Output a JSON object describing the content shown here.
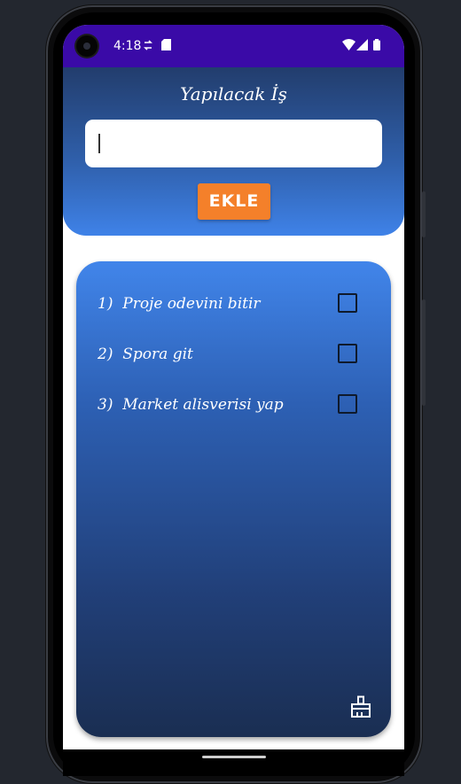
{
  "status_bar": {
    "time": "4:18",
    "left_icons": [
      "sync-icon",
      "sd-card-icon"
    ],
    "right_icons": [
      "wifi-icon",
      "signal-icon",
      "battery-icon"
    ],
    "color": "#3a0aa7"
  },
  "header": {
    "title": "Yapılacak İş",
    "input": {
      "value": "",
      "placeholder": ""
    },
    "add_button_label": "EKLE",
    "add_button_color": "#f4802a"
  },
  "tasks": [
    {
      "number": "1)",
      "text": "Proje odevini bitir",
      "checked": false
    },
    {
      "number": "2)",
      "text": "Spora git",
      "checked": false
    },
    {
      "number": "3)",
      "text": "Market alisverisi yap",
      "checked": false
    }
  ],
  "actions": {
    "clear_icon": "broom-icon"
  }
}
